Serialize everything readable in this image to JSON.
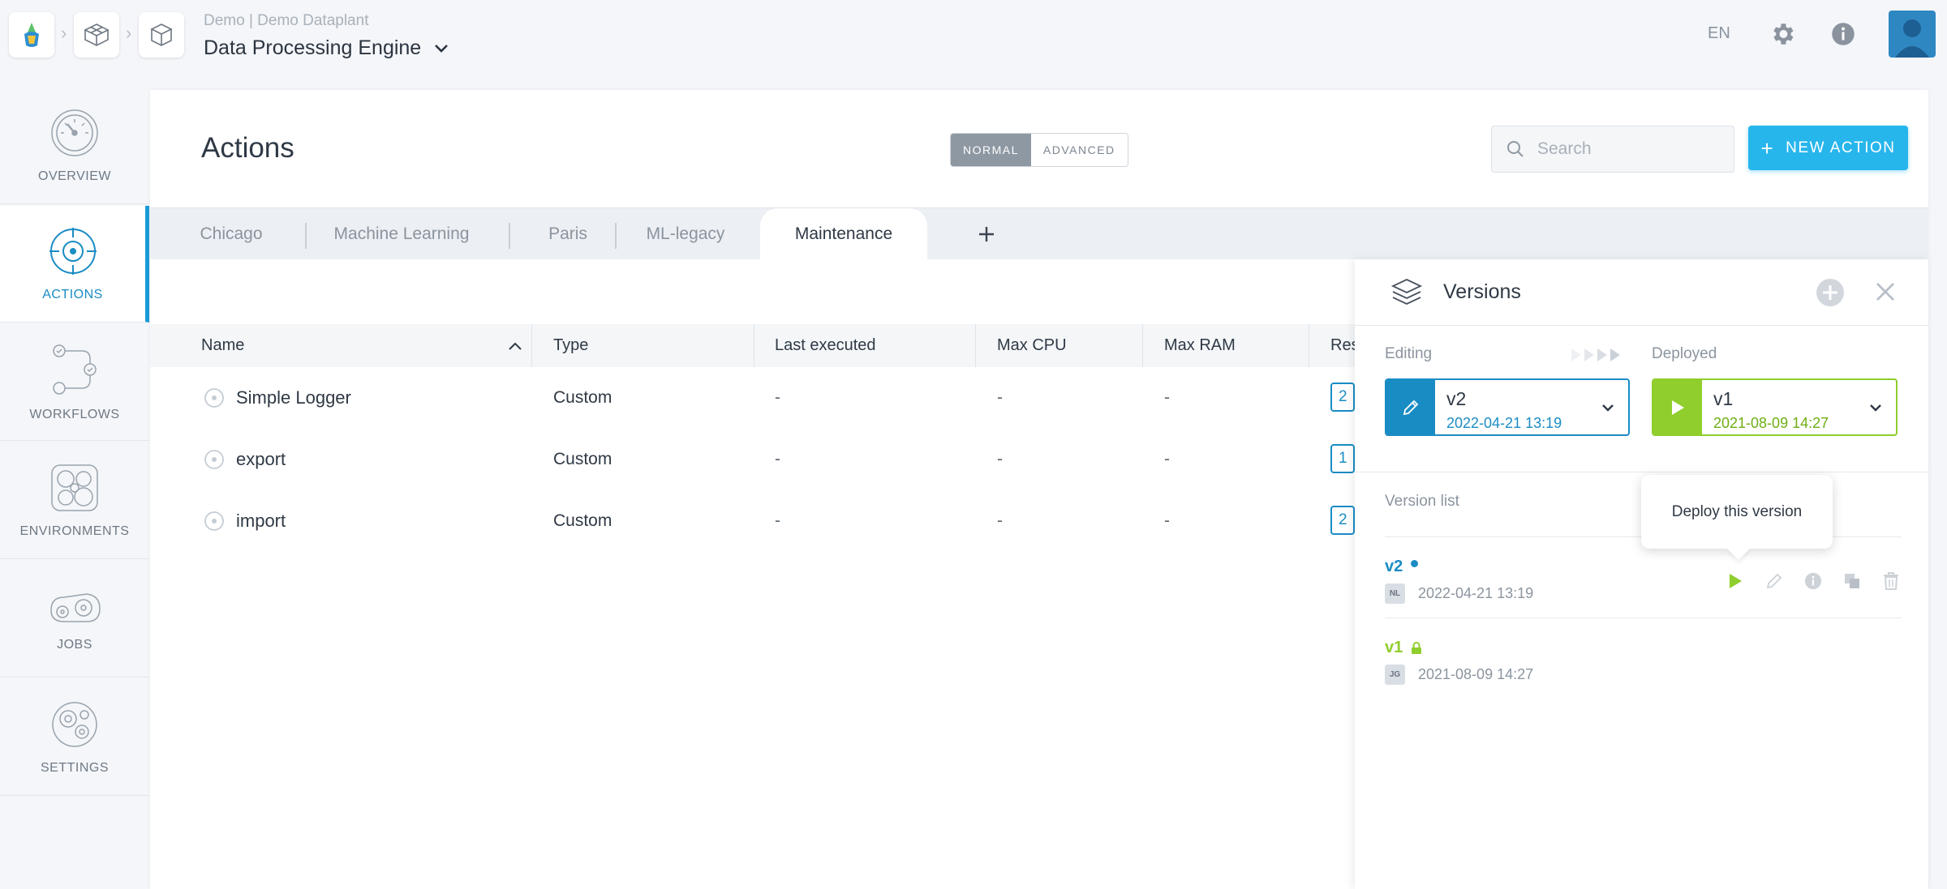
{
  "header": {
    "project_subtitle": "Demo | Demo Dataplant",
    "project_title": "Data Processing Engine",
    "language": "EN"
  },
  "sidebar": {
    "items": [
      {
        "label": "Overview",
        "icon": "gauge-icon"
      },
      {
        "label": "Actions",
        "icon": "target-icon"
      },
      {
        "label": "Workflows",
        "icon": "workflow-icon"
      },
      {
        "label": "Environments",
        "icon": "environment-icon"
      },
      {
        "label": "Jobs",
        "icon": "jobs-icon"
      },
      {
        "label": "Settings",
        "icon": "gear-icon"
      }
    ],
    "active": "Actions"
  },
  "page": {
    "title": "Actions",
    "mode_normal": "NORMAL",
    "mode_advanced": "ADVANCED",
    "search_placeholder": "Search",
    "new_action_label": "NEW ACTION"
  },
  "tabs": [
    "Chicago",
    "Machine Learning",
    "Paris",
    "ML-legacy",
    "Maintenance"
  ],
  "active_tab": "Maintenance",
  "table": {
    "columns": [
      "Name",
      "Type",
      "Last executed",
      "Max CPU",
      "Max RAM",
      "Res"
    ],
    "rows": [
      {
        "name": "Simple Logger",
        "type": "Custom",
        "last_executed": "-",
        "max_cpu": "-",
        "max_ram": "-",
        "res": "2"
      },
      {
        "name": "export",
        "type": "Custom",
        "last_executed": "-",
        "max_cpu": "-",
        "max_ram": "-",
        "res": "1"
      },
      {
        "name": "import",
        "type": "Custom",
        "last_executed": "-",
        "max_cpu": "-",
        "max_ram": "-",
        "res": "2"
      }
    ]
  },
  "versions": {
    "title": "Versions",
    "editing_label": "Editing",
    "deployed_label": "Deployed",
    "editing": {
      "name": "v2",
      "date": "2022-04-21 13:19"
    },
    "deployed": {
      "name": "v1",
      "date": "2021-08-09 14:27"
    },
    "list_label": "Version list",
    "tooltip": "Deploy this version",
    "list": [
      {
        "name": "v2",
        "initials": "NL",
        "date": "2022-04-21 13:19"
      },
      {
        "name": "v1",
        "initials": "JG",
        "date": "2021-08-09 14:27"
      }
    ]
  },
  "colors": {
    "accent": "#1a8cc4",
    "deployed": "#8fce2c",
    "button": "#27b6ec"
  }
}
